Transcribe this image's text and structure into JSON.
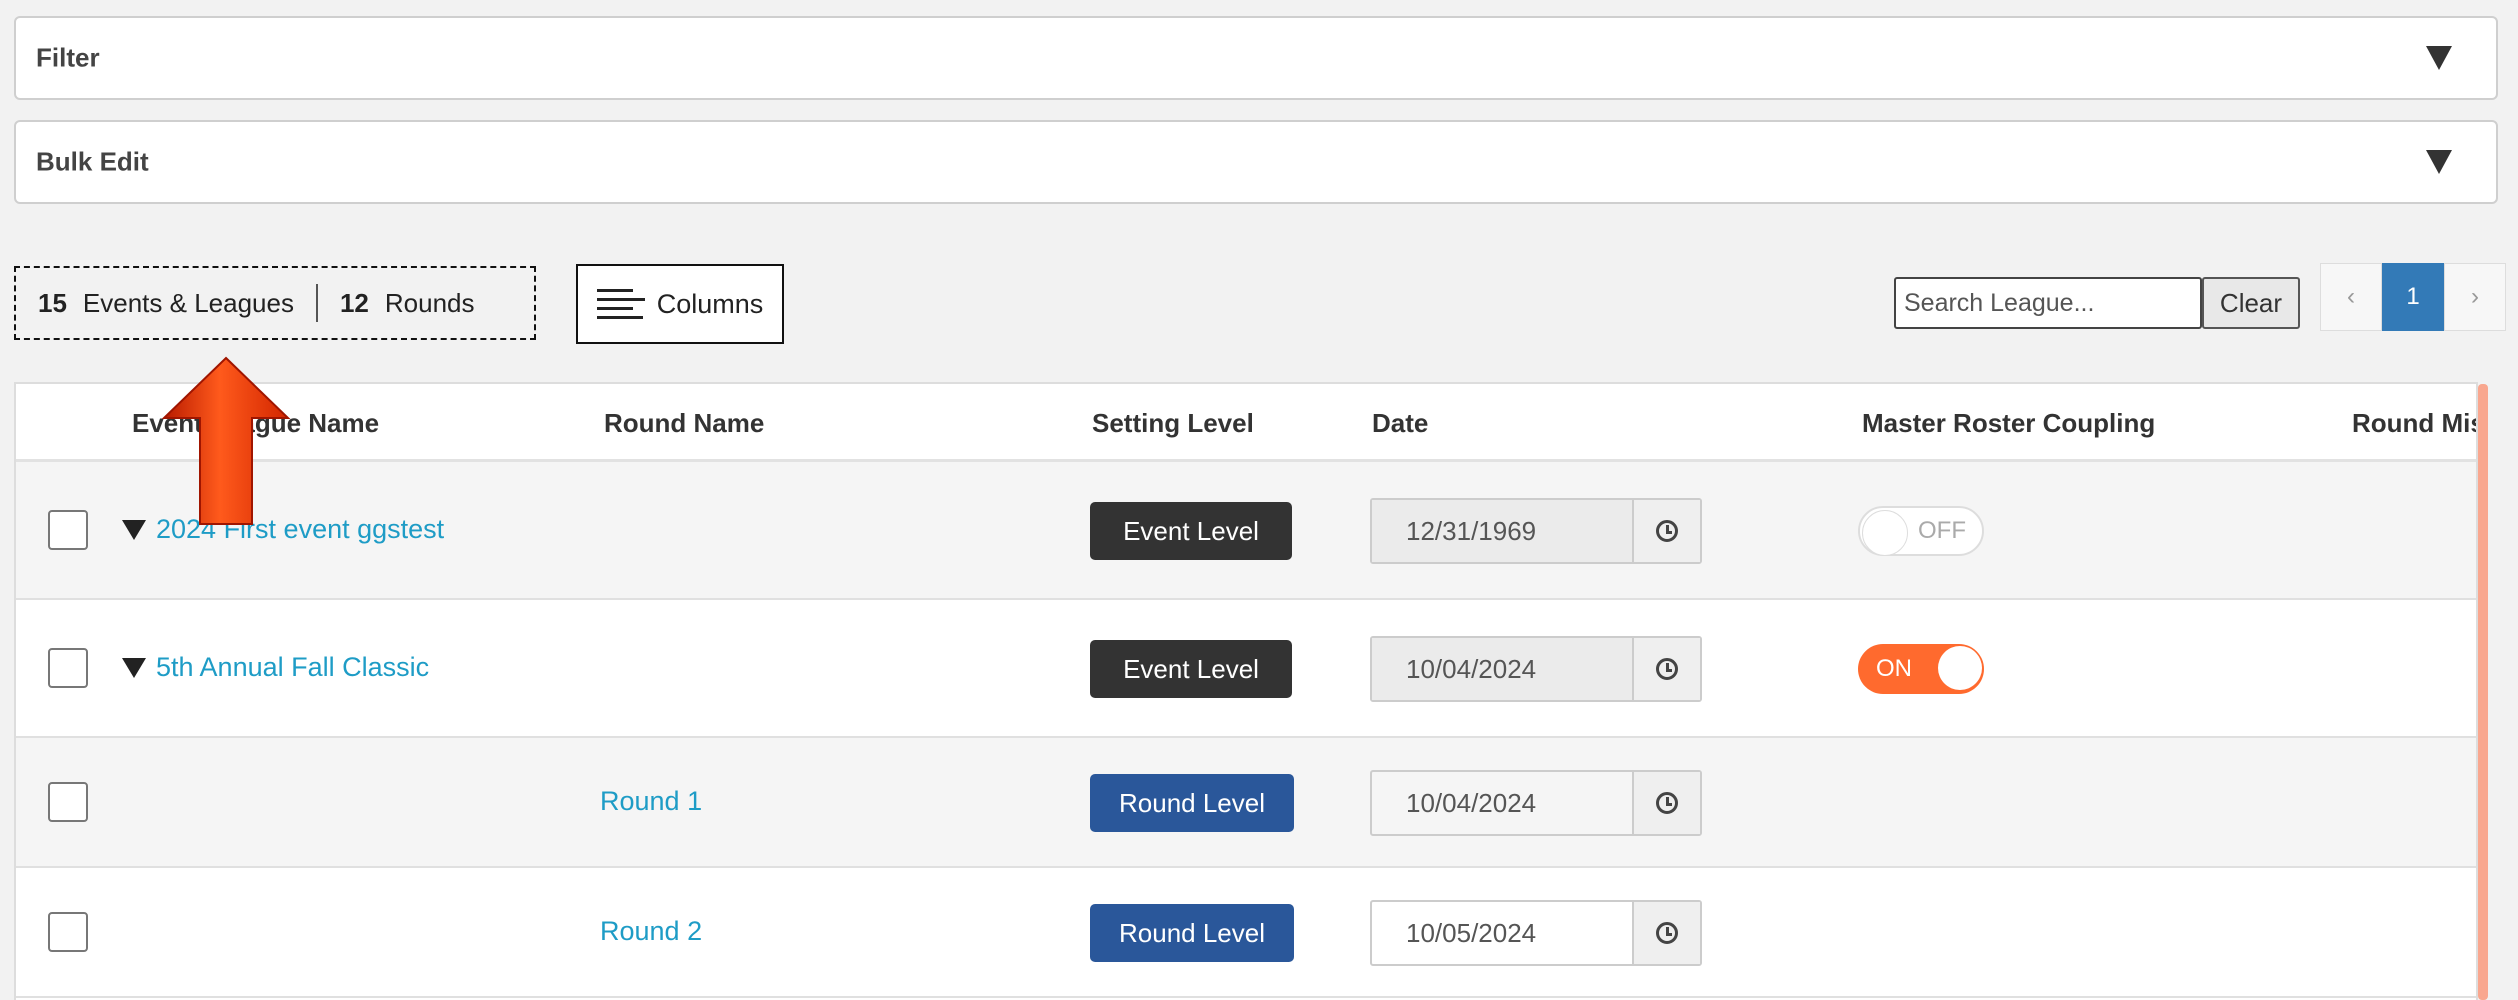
{
  "filter": {
    "title": "Filter"
  },
  "bulk_edit": {
    "title": "Bulk Edit"
  },
  "counts": {
    "events_count": "15",
    "events_label": "Events & Leagues",
    "rounds_count": "12",
    "rounds_label": "Rounds"
  },
  "columns_button": {
    "label": "Columns"
  },
  "search": {
    "placeholder": "Search League...",
    "value": ""
  },
  "clear_button": {
    "label": "Clear"
  },
  "pagination": {
    "prev": "‹",
    "current": "1",
    "next": "›"
  },
  "table": {
    "headers": {
      "event_league_name": "Event/League Name",
      "round_name": "Round Name",
      "setting_level": "Setting Level",
      "date": "Date",
      "master_roster_coupling": "Master Roster Coupling",
      "round_mis": "Round Mis"
    },
    "rows": [
      {
        "event_name": "2024 First event ggstest",
        "round_name": "",
        "level": "Event Level",
        "date": "12/31/1969",
        "coupling": "OFF"
      },
      {
        "event_name": "5th Annual Fall Classic",
        "round_name": "",
        "level": "Event Level",
        "date": "10/04/2024",
        "coupling": "ON"
      },
      {
        "event_name": "",
        "round_name": "Round 1",
        "level": "Round Level",
        "date": "10/04/2024",
        "coupling": ""
      },
      {
        "event_name": "",
        "round_name": "Round 2",
        "level": "Round Level",
        "date": "10/05/2024",
        "coupling": ""
      }
    ]
  },
  "colors": {
    "accent_link": "#1e9cc6",
    "toggle_on": "#ff6a2e",
    "round_badge": "#2a579a",
    "event_badge": "#333333",
    "page_active": "#337ab7"
  },
  "icons": {
    "collapse": "caret-down-icon",
    "clock": "clock-icon",
    "columns": "lines-icon",
    "annotation": "red-up-arrow"
  }
}
